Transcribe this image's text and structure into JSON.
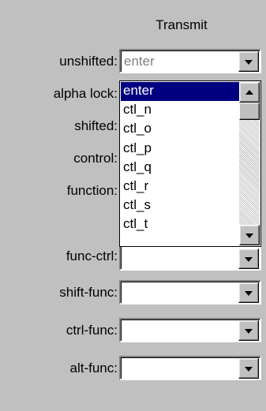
{
  "header": {
    "title": "Transmit"
  },
  "rows": [
    {
      "label": "unshifted:",
      "value": "enter"
    },
    {
      "label": "alpha lock:",
      "value": ""
    },
    {
      "label": "shifted:",
      "value": ""
    },
    {
      "label": "control:",
      "value": ""
    },
    {
      "label": "function:",
      "value": ""
    },
    {
      "label": "func-ctrl:",
      "value": ""
    },
    {
      "label": "shift-func:",
      "value": ""
    },
    {
      "label": "ctrl-func:",
      "value": ""
    },
    {
      "label": "alt-func:",
      "value": ""
    }
  ],
  "dropdown": {
    "items": [
      "enter",
      "ctl_n",
      "ctl_o",
      "ctl_p",
      "ctl_q",
      "ctl_r",
      "ctl_s",
      "ctl_t"
    ],
    "selected_index": 0
  },
  "icons": {
    "dropdown_button": "chevron-down-icon",
    "scroll_up": "chevron-up-icon",
    "scroll_down": "chevron-down-icon"
  },
  "colors": {
    "background": "#c0c0c0",
    "selection": "#000080",
    "disabled_text": "#808080"
  }
}
